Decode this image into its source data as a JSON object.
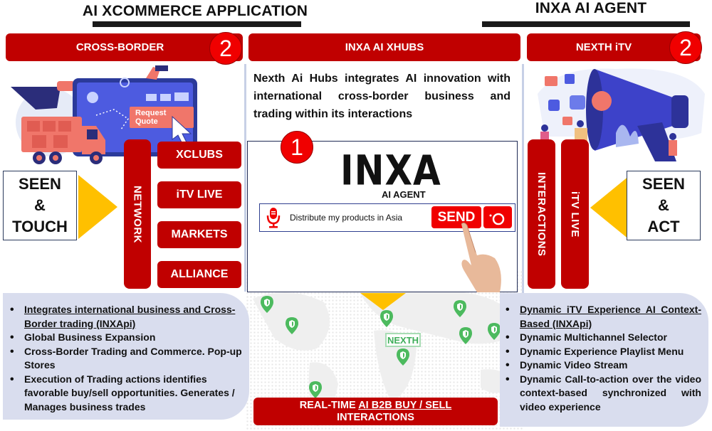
{
  "titles": {
    "left": "AI XCOMMERCE APPLICATION",
    "right": "INXA AI AGENT"
  },
  "headers": {
    "cross_border": "CROSS-BORDER",
    "xhubs": "INXA AI XHUBS",
    "nexth_itv": "NEXTH iTV"
  },
  "badges": {
    "left": "2",
    "center": "1",
    "right": "2"
  },
  "left_column": {
    "illustration": {
      "button_label": "Request Quote"
    },
    "seen_box": [
      "SEEN",
      "&",
      "TOUCH"
    ],
    "network_label": "NETWORK",
    "network_items": [
      "XCLUBS",
      "iTV LIVE",
      "MARKETS",
      "ALLIANCE"
    ],
    "bullets": [
      {
        "text": "Integrates international business and Cross-Border trading (INXApi)",
        "underline": true
      },
      {
        "text": "Global Business Expansion",
        "underline": false
      },
      {
        "text": "Cross-Border Trading and Commerce. Pop-up Stores",
        "underline": false
      },
      {
        "text": "Execution of Trading actions identifies favorable buy/sell opportunities. Generates / Manages business trades",
        "underline": false
      }
    ]
  },
  "center_column": {
    "intro": "Nexth Ai Hubs integrates AI innovation with international cross-border business and trading within its interactions",
    "agent": {
      "logo": "INXA",
      "subtitle": "AI AGENT",
      "prompt_text": "Distribute my products in Asia",
      "mic_icon": "microphone-icon",
      "send_label": "SEND",
      "camera_icon": "camera-icon"
    },
    "map": {
      "tag": "NEXTH",
      "pin_icon": "shield-map-pin-icon"
    },
    "realtime_bar": {
      "prefix": "REAL-TIME ",
      "underlined": "AI B2B BUY / SELL",
      "line2": "INTERACTIONS"
    }
  },
  "right_column": {
    "interactions_label": "INTERACTIONS",
    "itv_live_label": "iTV LIVE",
    "seen_box": [
      "SEEN",
      "&",
      "ACT"
    ],
    "bullets": [
      {
        "text": "Dynamic iTV Experience AI Context-Based (INXApi)",
        "underline": true
      },
      {
        "text": "Dynamic Multichannel Selector",
        "underline": false
      },
      {
        "text": "Dynamic Experience Playlist Menu",
        "underline": false
      },
      {
        "text": "Dynamic Video Stream",
        "underline": false
      },
      {
        "text": "Dynamic Call-to-action over the video context-based synchronized with video experience",
        "underline": false
      }
    ]
  },
  "colors": {
    "brand_red": "#c00000",
    "badge_red": "#f00000",
    "accent_yellow": "#ffc000",
    "panel_bg": "#d9ddee",
    "pin_green": "#4cba5e"
  }
}
